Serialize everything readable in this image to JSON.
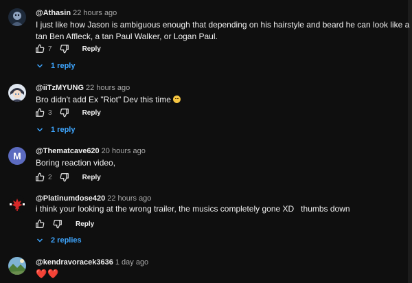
{
  "comments": [
    {
      "author": "@Athasin",
      "time": "22 hours ago",
      "text": "I just like how Jason is ambiguous enough that depending on his hairstyle and beard he can look like a tan Ben Affleck, a tan Paul Walker, or Logan Paul.",
      "likes": "7",
      "reply_label": "Reply",
      "replies_label": "1 reply",
      "avatar_icon": "avatar-dark-character-icon"
    },
    {
      "author": "@iiTzMYUNG",
      "time": "22 hours ago",
      "text": "Bro didn't add Ex \"Riot\" Dev this time",
      "text_emoji": "smirk-face-emoji",
      "likes": "3",
      "reply_label": "Reply",
      "replies_label": "1 reply",
      "avatar_icon": "avatar-anime-character-icon"
    },
    {
      "author": "@Thematcave620",
      "time": "20 hours ago",
      "text": "Boring reaction video,",
      "likes": "2",
      "reply_label": "Reply",
      "avatar_letter": "M",
      "avatar_color": "#5c6bc0"
    },
    {
      "author": "@Platinumdose420",
      "time": "22 hours ago",
      "text": "i think your looking at the wrong trailer, the musics completely gone XD   thumbs down",
      "reply_label": "Reply",
      "replies_label": "2 replies",
      "avatar_icon": "avatar-canada-flag-icon"
    },
    {
      "author": "@kendravoracek3636",
      "time": "1 day ago",
      "text": "❤️❤️",
      "avatar_icon": "avatar-landscape-photo-icon"
    }
  ],
  "colors": {
    "background": "#0f0f0f",
    "text_primary": "#f1f1f1",
    "text_secondary": "#aaaaaa",
    "link_blue": "#3ea6ff",
    "heart_red": "#e53935"
  }
}
